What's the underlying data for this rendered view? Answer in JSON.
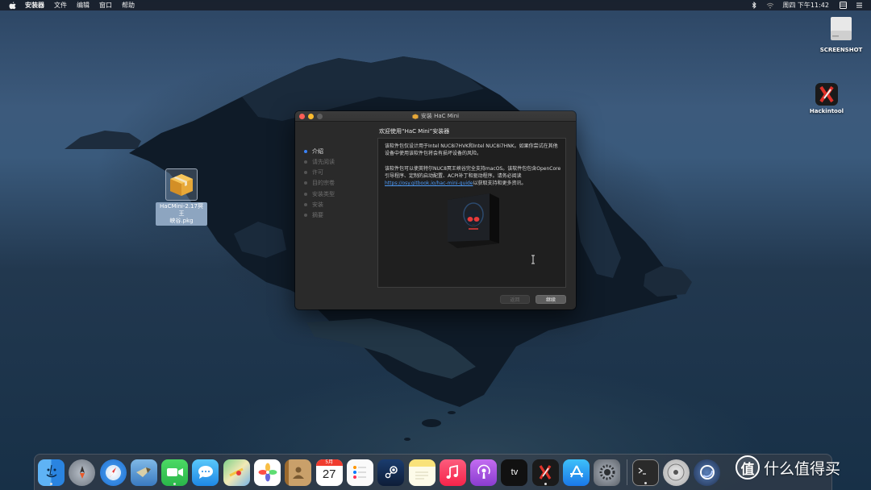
{
  "menubar": {
    "app_name": "安装器",
    "items": [
      "文件",
      "编辑",
      "窗口",
      "帮助"
    ],
    "clock": "周四 下午11:42"
  },
  "desktop": {
    "pkg_label_line1": "HaCMini-2.17冥王",
    "pkg_label_line2": "峡谷.pkg",
    "screenshot_label": "SCREENSHOT",
    "hackintool_label": "Hackintool"
  },
  "window": {
    "title": "安装 HaC Mini",
    "heading": "欢迎使用“HaC Mini”安装器",
    "steps": [
      "介绍",
      "请先阅读",
      "许可",
      "目的宗卷",
      "安装类型",
      "安装",
      "摘要"
    ],
    "para1": "该软件包仅设计用于Intel NUC8i7HVK和Intel NUC8i7HNK。如果你尝试在其他设备中使用该软件包将会有损坏设备的风险。",
    "para2_before": "该软件包可以使英特尔NUC8冥王峡谷完全支持macOS。该软件包包含OpenCore引导程序、定制的启动配置、ACPI补丁和驱动程序。请务必阅读",
    "para2_link": "https://osy.gitbook.io/hac-mini-guide",
    "para2_after": "以获取支持和更多资讯。",
    "back_button": "返回",
    "continue_button": "继续"
  },
  "dock": {
    "apps": [
      "finder",
      "launchpad",
      "safari",
      "mail",
      "facetime",
      "messages",
      "maps",
      "photos",
      "contacts",
      "calendar",
      "reminders",
      "steam",
      "notes",
      "music",
      "podcasts",
      "tv",
      "hackintool",
      "app-store",
      "system-preferences",
      "terminal",
      "dvd-player",
      "cinema4d"
    ],
    "calendar_month": "5月",
    "calendar_day": "27",
    "tv_label": "tv"
  },
  "watermark": {
    "badge": "值",
    "text": "什么值得买"
  },
  "colors": {
    "accent": "#3a82f7",
    "link": "#4e9bf8"
  }
}
